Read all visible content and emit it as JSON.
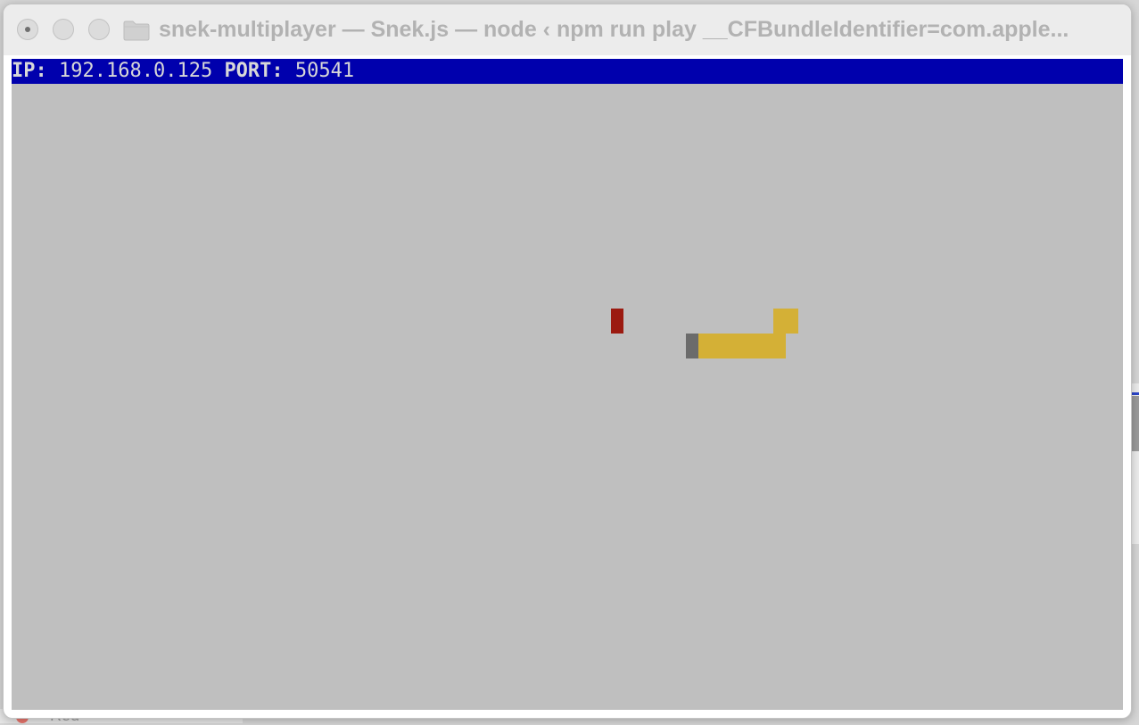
{
  "window": {
    "title": "snek-multiplayer — Snek.js — node ‹ npm run play __CFBundleIdentifier=com.apple..."
  },
  "status": {
    "ip_label": "IP:",
    "ip_value": "192.168.0.125",
    "port_label": "PORT:",
    "port_value": "50541"
  },
  "background": {
    "sidebar_label": "Red"
  },
  "colors": {
    "terminal_bg": "#bfbfbf",
    "status_bar_bg": "#0000ad",
    "food": "#9b1a10",
    "snake_body": "#d4b036",
    "snake_head": "#6b6b6b"
  },
  "icons": {
    "title_icon": "folder-icon"
  }
}
